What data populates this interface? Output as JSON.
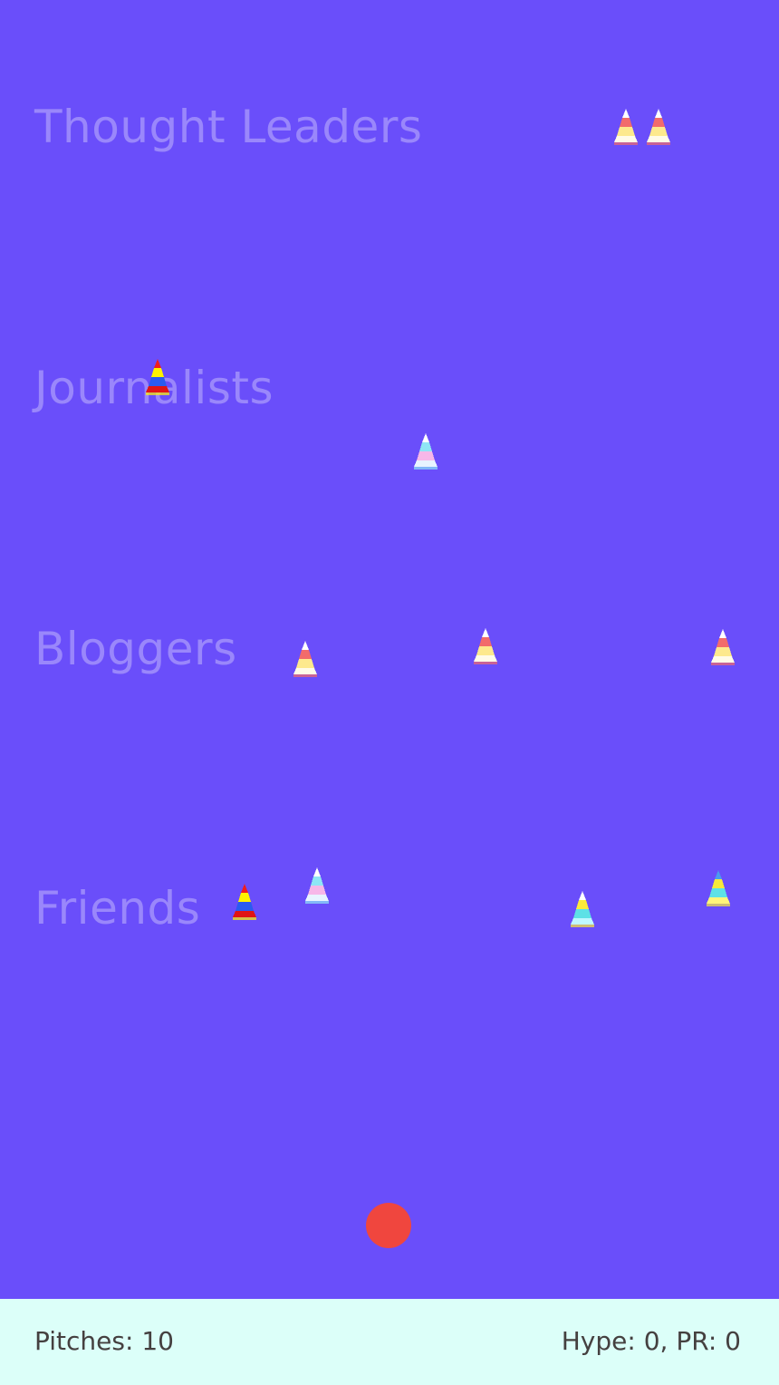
{
  "rows": {
    "thought_leaders": "Thought Leaders",
    "journalists": "Journalists",
    "bloggers": "Bloggers",
    "friends": "Friends"
  },
  "status": {
    "pitches_label": "Pitches:",
    "pitches_value": "10",
    "hype_label": "Hype:",
    "hype_value": "0",
    "pr_label": "PR:",
    "pr_value": "0"
  },
  "colors": {
    "field": "#6a4efa",
    "status_bar": "#dcfff9",
    "ball": "#f0463e",
    "row_label": "rgba(255,255,255,0.32)",
    "status_text": "#454040"
  },
  "icons": {
    "target": "party-hat-icon",
    "ball": "pitch-ball"
  },
  "targets": [
    {
      "row": "thought_leaders",
      "style": "candy-corn"
    },
    {
      "row": "thought_leaders",
      "style": "candy-corn"
    },
    {
      "row": "journalists",
      "style": "primary"
    },
    {
      "row": "journalists",
      "style": "pastel"
    },
    {
      "row": "bloggers",
      "style": "candy-corn"
    },
    {
      "row": "bloggers",
      "style": "candy-corn"
    },
    {
      "row": "bloggers",
      "style": "candy-corn"
    },
    {
      "row": "friends",
      "style": "primary"
    },
    {
      "row": "friends",
      "style": "pastel"
    },
    {
      "row": "friends",
      "style": "aqua-yellow"
    },
    {
      "row": "friends",
      "style": "yellow-blue"
    }
  ]
}
